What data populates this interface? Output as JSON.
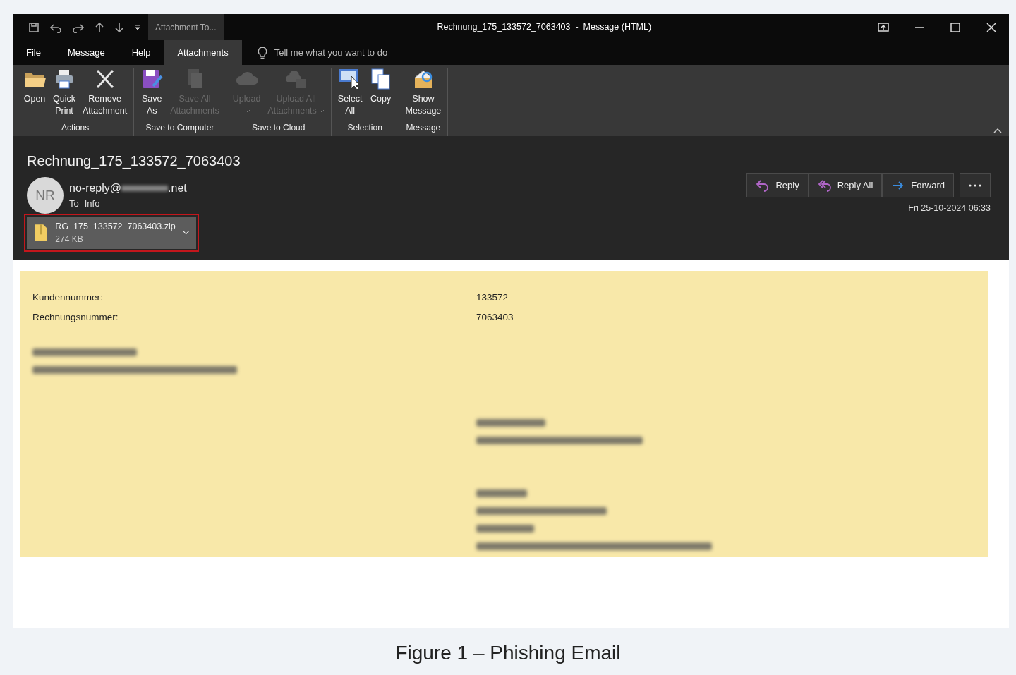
{
  "window": {
    "contextual_tab": "Attachment To...",
    "title": "Rechnung_175_133572_7063403  -  Message (HTML)"
  },
  "tabs": [
    {
      "label": "File",
      "selected": false
    },
    {
      "label": "Message",
      "selected": false
    },
    {
      "label": "Help",
      "selected": false
    },
    {
      "label": "Attachments",
      "selected": true
    }
  ],
  "tell_me": {
    "placeholder": "Tell me what you want to do"
  },
  "ribbon_groups": [
    {
      "label": "Actions",
      "buttons": [
        {
          "kind": "open",
          "lines": [
            "Open"
          ],
          "disabled": false
        },
        {
          "kind": "print",
          "lines": [
            "Quick",
            "Print"
          ],
          "disabled": false
        },
        {
          "kind": "remove",
          "lines": [
            "Remove",
            "Attachment"
          ],
          "disabled": false
        }
      ]
    },
    {
      "label": "Save to Computer",
      "buttons": [
        {
          "kind": "save",
          "lines": [
            "Save",
            "As"
          ],
          "disabled": false
        },
        {
          "kind": "saveall",
          "lines": [
            "Save All",
            "Attachments"
          ],
          "disabled": true
        }
      ]
    },
    {
      "label": "Save to Cloud",
      "buttons": [
        {
          "kind": "cloud",
          "lines": [
            "Upload"
          ],
          "disabled": true,
          "dropdown": true
        },
        {
          "kind": "cloudall",
          "lines": [
            "Upload All",
            "Attachments"
          ],
          "disabled": true,
          "dropdown": true
        }
      ]
    },
    {
      "label": "Selection",
      "buttons": [
        {
          "kind": "select",
          "lines": [
            "Select",
            "All"
          ],
          "disabled": false
        },
        {
          "kind": "copy",
          "lines": [
            "Copy"
          ],
          "disabled": false
        }
      ]
    },
    {
      "label": "Message",
      "buttons": [
        {
          "kind": "show",
          "lines": [
            "Show",
            "Message"
          ],
          "disabled": false
        }
      ]
    }
  ],
  "message": {
    "subject": "Rechnung_175_133572_7063403",
    "avatar_initials": "NR",
    "sender_prefix": "no-reply@",
    "sender_suffix": ".net",
    "to_label": "To",
    "to_value": "Info",
    "date": "Fri 25-10-2024 06:33",
    "actions": [
      {
        "kind": "reply",
        "label": "Reply"
      },
      {
        "kind": "replyall",
        "label": "Reply All"
      },
      {
        "kind": "forward",
        "label": "Forward"
      }
    ],
    "attachment": {
      "name": "RG_175_133572_7063403.zip",
      "size": "274 KB",
      "highlighted": true
    }
  },
  "body": {
    "fields": [
      {
        "label": "Kundennummer:",
        "value": "133572"
      },
      {
        "label": "Rechnungsnummer:",
        "value": "7063403"
      }
    ]
  },
  "caption": "Figure 1 – Phishing Email"
}
